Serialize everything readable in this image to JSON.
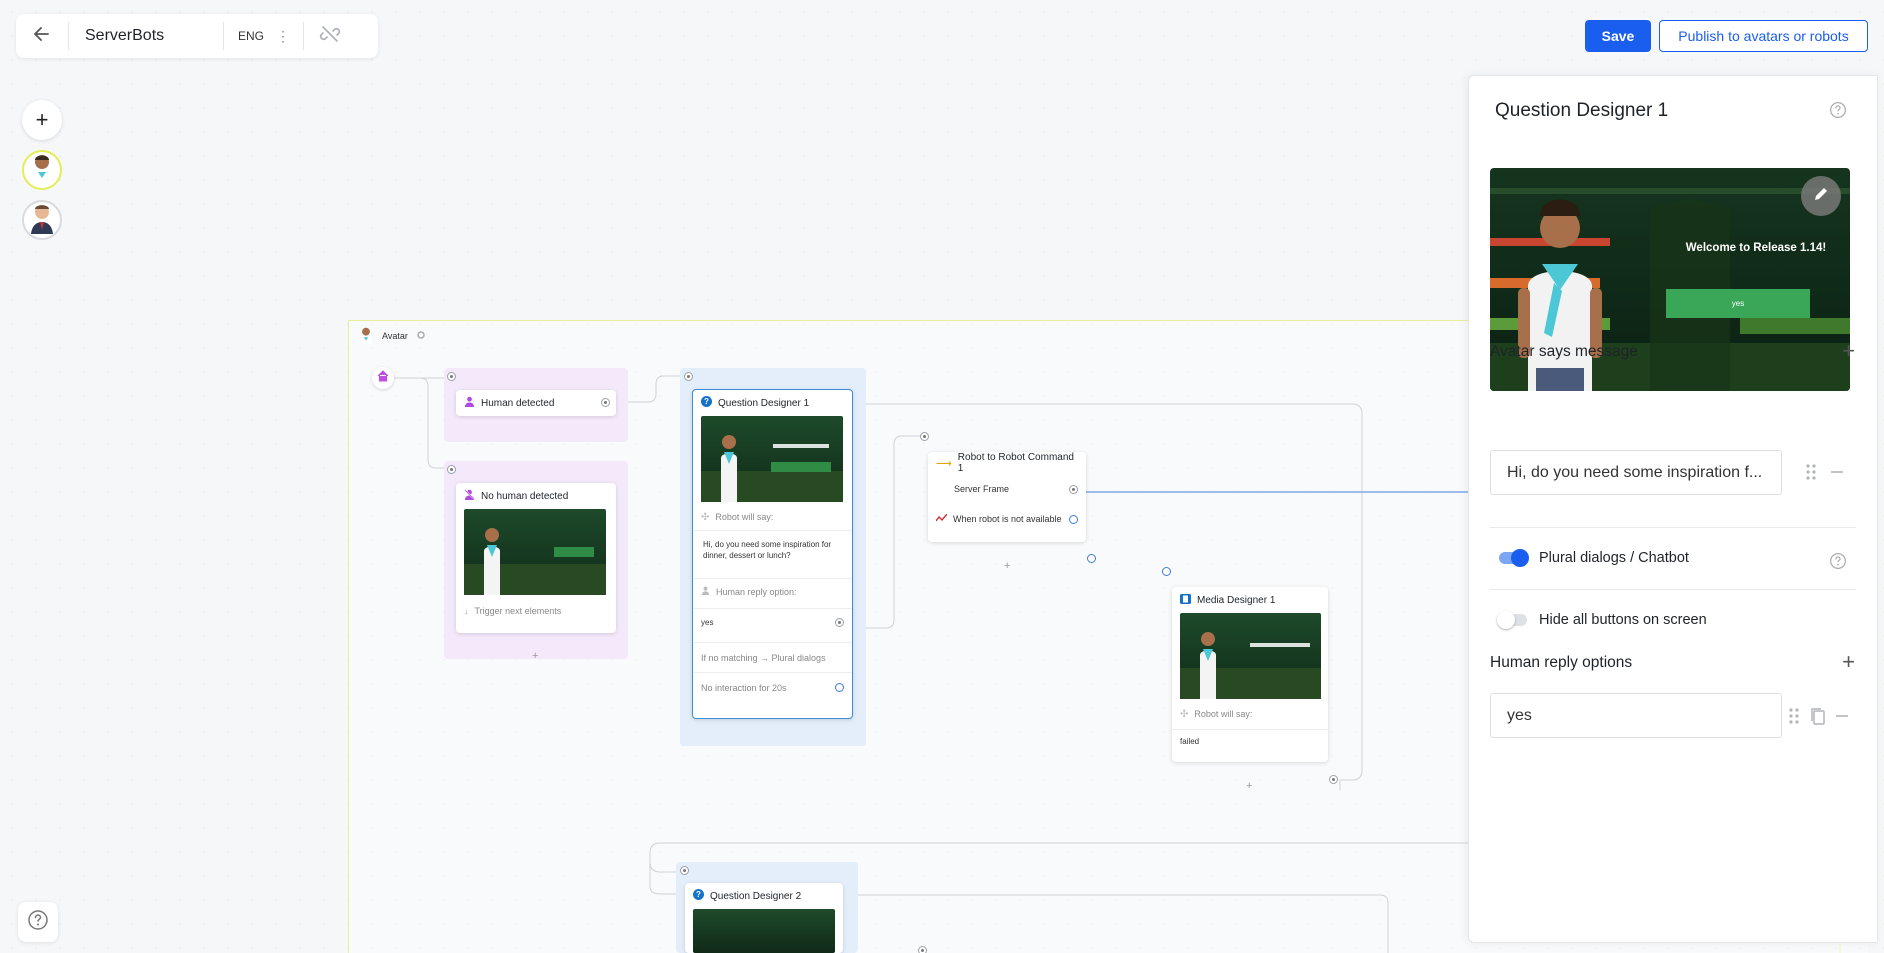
{
  "header": {
    "back_icon": "arrow-left-icon",
    "title": "ServerBots",
    "language": "ENG",
    "more_icon": "more-vertical-icon",
    "link_icon": "link-off-icon"
  },
  "actions": {
    "save_label": "Save",
    "publish_label": "Publish to avatars or robots",
    "accent": "#1a5ef0"
  },
  "rail": {
    "add_icon": "plus-icon",
    "add_label": "+",
    "avatars": [
      "avatar-boy-icon",
      "avatar-man-icon"
    ],
    "help_icon": "help-circle-icon"
  },
  "canvas": {
    "group_label": "Avatar",
    "nodes": {
      "human_detected": {
        "title": "Human detected"
      },
      "no_human_detected": {
        "title": "No human detected",
        "footer": "Trigger next elements"
      },
      "question_designer_1": {
        "title": "Question Designer 1",
        "robot_will_say_label": "Robot will say:",
        "robot_says": "Hi, do you need some inspiration for dinner, dessert or lunch?",
        "reply_label": "Human reply option:",
        "reply_value": "yes",
        "no_match": "If no matching → Plural dialogs",
        "no_interaction": "No interaction for 20s"
      },
      "robot_command": {
        "title": "Robot to Robot Command 1",
        "server_frame": "Server Frame",
        "not_available": "When robot is not available"
      },
      "media_designer": {
        "title": "Media Designer 1",
        "robot_will_say_label": "Robot will say:",
        "robot_says": "failed"
      },
      "question_designer_2": {
        "title": "Question Designer 2"
      }
    },
    "add_symbol": "+"
  },
  "panel": {
    "title": "Question Designer 1",
    "help_icon": "help-circle-icon",
    "preview": {
      "headline": "Welcome to Release 1.14!",
      "button_label": "yes",
      "edit_icon": "pencil-icon"
    },
    "avatar_says": {
      "title": "Avatar says message",
      "add_symbol": "+",
      "message": "Hi, do you need some inspiration f..."
    },
    "plural_dialogs": {
      "label": "Plural dialogs / Chatbot",
      "enabled": true
    },
    "hide_buttons": {
      "label": "Hide all buttons on screen",
      "enabled": false
    },
    "human_reply": {
      "title": "Human reply options",
      "add_symbol": "+",
      "options": [
        "yes"
      ]
    }
  }
}
